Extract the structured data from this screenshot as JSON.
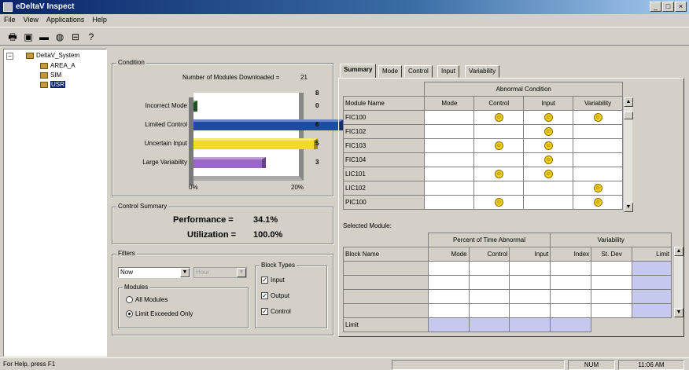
{
  "window": {
    "title": "eDeltaV Inspect",
    "min": "_",
    "max": "□",
    "close": "×"
  },
  "menu": [
    "File",
    "View",
    "Applications",
    "Help"
  ],
  "toolbar_icons": [
    "printer-icon",
    "save-icon",
    "card-icon",
    "palette-icon",
    "lock-icon",
    "help-icon"
  ],
  "tree": {
    "root": "DeltaV_System",
    "children": [
      "AREA_A",
      "SIM",
      "USR"
    ],
    "expander": "−"
  },
  "condition": {
    "label": "Condition",
    "downloaded_label": "Number of Modules Downloaded =",
    "downloaded_value": "21",
    "top_value": "8",
    "rows": [
      {
        "name": "Incorrect Mode",
        "count": "0",
        "fraction": 0.0,
        "color": "#2e7d32"
      },
      {
        "name": "Limited Control",
        "count": "6",
        "fraction": 0.29,
        "color": "#1f4aa8"
      },
      {
        "name": "Uncertain Input",
        "count": "5",
        "fraction": 0.24,
        "color": "#f2dc1e"
      },
      {
        "name": "Large Variability",
        "count": "3",
        "fraction": 0.14,
        "color": "#9b68c5"
      }
    ],
    "axis_min": "0%",
    "axis_max": "20%"
  },
  "control_summary": {
    "label": "Control Summary",
    "performance_label": "Performance =",
    "performance_value": "34.1%",
    "utilization_label": "Utilization =",
    "utilization_value": "100.0%"
  },
  "filters": {
    "label": "Filters",
    "filter1_value": "Now",
    "filter2_value": "Hour",
    "modules_label": "Modules",
    "all_modules": "All Modules",
    "limit_exceeded": "Limit Exceeded Only",
    "block_types_label": "Block Types",
    "input": "Input",
    "output": "Output",
    "control": "Control"
  },
  "tabs": [
    "Summary",
    "Mode",
    "Control",
    "Input",
    "Variability"
  ],
  "abnormal": {
    "group_header": "Abnormal Condition",
    "headers": [
      "Module Name",
      "Mode",
      "Control",
      "Input",
      "Variability"
    ],
    "rows": [
      {
        "name": "FIC100",
        "mode": false,
        "control": true,
        "input": true,
        "variability": true
      },
      {
        "name": "FIC102",
        "mode": false,
        "control": false,
        "input": true,
        "variability": false
      },
      {
        "name": "FIC103",
        "mode": false,
        "control": true,
        "input": true,
        "variability": false
      },
      {
        "name": "FIC104",
        "mode": false,
        "control": false,
        "input": true,
        "variability": false
      },
      {
        "name": "LIC101",
        "mode": false,
        "control": true,
        "input": true,
        "variability": false
      },
      {
        "name": "LIC102",
        "mode": false,
        "control": false,
        "input": false,
        "variability": true
      },
      {
        "name": "PIC100",
        "mode": false,
        "control": true,
        "input": false,
        "variability": true
      }
    ],
    "smile_glyph": "☺"
  },
  "selected_module": {
    "label": "Selected Module:",
    "pct_header": "Percent of Time Abnormal",
    "var_header": "Variability",
    "headers": [
      "Block Name",
      "Mode",
      "Control",
      "Input",
      "Index",
      "St. Dev",
      "Limit"
    ],
    "limit_row": "Limit"
  },
  "status": {
    "help": "For Help, press F1",
    "num": "NUM",
    "time": "11:06 AM"
  }
}
